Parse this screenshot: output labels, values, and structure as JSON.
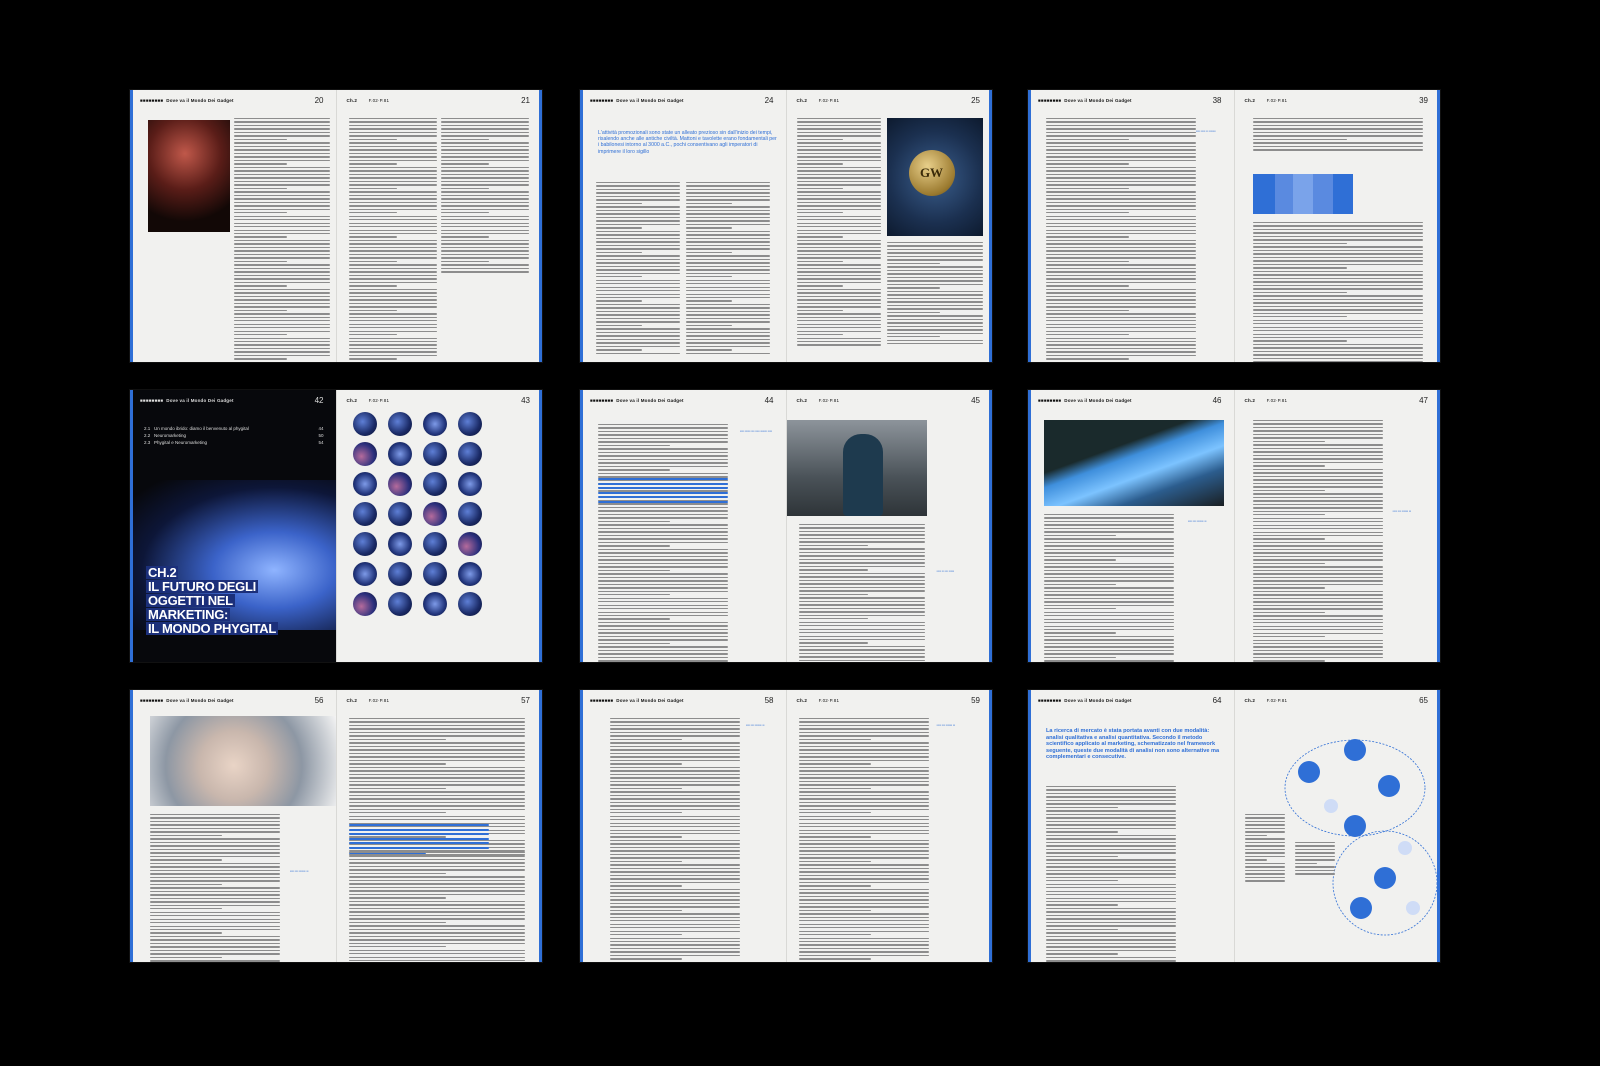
{
  "book_title": "Dove va il Mondo Dei Gadget",
  "chapter_tag": "Ch.2",
  "chapter_title_lines": [
    "CH.2",
    "IL FUTURO DEGLI",
    "OGGETTI NEL",
    "MARKETING:",
    "IL MONDO PHYGITAL"
  ],
  "toc": [
    {
      "num": "2.1",
      "label": "Un mondo ibrido: diamo il benvenuto al phygital",
      "page": "44"
    },
    {
      "num": "2.2",
      "label": "Neuromarketing",
      "page": "50"
    },
    {
      "num": "2.3",
      "label": "Phygital e Neuromarketing",
      "page": "54"
    }
  ],
  "spreads": [
    {
      "left_page": "20",
      "right_page": "21"
    },
    {
      "left_page": "24",
      "right_page": "25"
    },
    {
      "left_page": "38",
      "right_page": "39"
    },
    {
      "left_page": "42",
      "right_page": "43"
    },
    {
      "left_page": "44",
      "right_page": "45"
    },
    {
      "left_page": "46",
      "right_page": "47"
    },
    {
      "left_page": "56",
      "right_page": "57"
    },
    {
      "left_page": "58",
      "right_page": "59"
    },
    {
      "left_page": "64",
      "right_page": "65"
    }
  ],
  "pull_quote_24": "L'attività promozionali sono state un alleato prezioso sin dall'inizio dei tempi, risalendo anche alle antiche civiltà. Mattoni e tavolette erano fondamentali per i babilonesi intorno al 3000 a.C., pochi consentivano agli imperatori di imprimere il loro sigillo",
  "pull_quote_64": "La ricerca di mercato è stata portata avanti con due modalità: analisi qualitativa e analisi quantitativa. Secondo il metodo scientifico applicato al marketing, schematizzato nel framework seguente, queste due modalità di analisi non sono alternative ma complementari e consecutive.",
  "seal_text": "GW",
  "colors": {
    "accent": "#2f6fd6",
    "paper": "#f1f1ef",
    "background": "#000000"
  }
}
